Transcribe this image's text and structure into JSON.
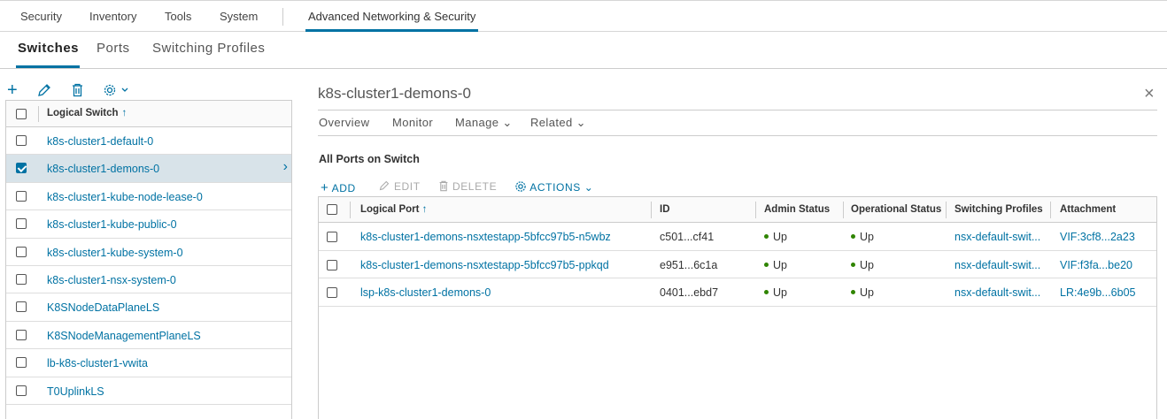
{
  "top_nav": {
    "items": [
      "Security",
      "Inventory",
      "Tools",
      "System"
    ],
    "active": "Advanced Networking & Security"
  },
  "sub_nav": {
    "tabs": [
      "Switches",
      "Ports",
      "Switching Profiles"
    ]
  },
  "left_toolbar": {
    "icons": [
      "plus-icon",
      "pencil-icon",
      "trash-icon",
      "gear-icon"
    ]
  },
  "switch_list": {
    "header": "Logical Switch",
    "sort_icon": "↑",
    "selected_index": 1,
    "items": [
      "k8s-cluster1-default-0",
      "k8s-cluster1-demons-0",
      "k8s-cluster1-kube-node-lease-0",
      "k8s-cluster1-kube-public-0",
      "k8s-cluster1-kube-system-0",
      "k8s-cluster1-nsx-system-0",
      "K8SNodeDataPlaneLS",
      "K8SNodeManagementPlaneLS",
      "lb-k8s-cluster1-vwita",
      "T0UplinkLS"
    ]
  },
  "detail": {
    "title": "k8s-cluster1-demons-0",
    "close_icon": "×",
    "tabs": [
      "Overview",
      "Monitor",
      "Manage ⌄",
      "Related ⌄"
    ],
    "section_title": "All Ports on Switch",
    "actions": {
      "add": "ADD",
      "edit": "EDIT",
      "delete": "DELETE",
      "actions": "ACTIONS ⌄"
    }
  },
  "ports_table": {
    "columns": [
      "Logical Port",
      "ID",
      "Admin Status",
      "Operational Status",
      "Switching Profiles",
      "Attachment"
    ],
    "sort_icon": "↑",
    "status_color": "#2f8400",
    "accent_color": "#0072a3",
    "rows": [
      {
        "port": "k8s-cluster1-demons-nsxtestapp-5bfcc97b5-n5wbz",
        "id": "c501...cf41",
        "admin": "Up",
        "oper": "Up",
        "profiles": "nsx-default-swit...",
        "attachment": "VIF:3cf8...2a23"
      },
      {
        "port": "k8s-cluster1-demons-nsxtestapp-5bfcc97b5-ppkqd",
        "id": "e951...6c1a",
        "admin": "Up",
        "oper": "Up",
        "profiles": "nsx-default-swit...",
        "attachment": "VIF:f3fa...be20"
      },
      {
        "port": "lsp-k8s-cluster1-demons-0",
        "id": "0401...ebd7",
        "admin": "Up",
        "oper": "Up",
        "profiles": "nsx-default-swit...",
        "attachment": "LR:4e9b...6b05"
      }
    ]
  }
}
